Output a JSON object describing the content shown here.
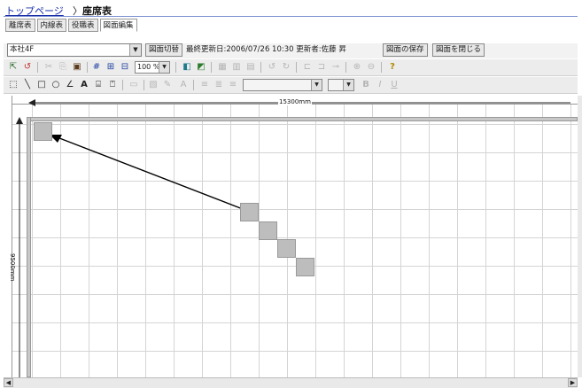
{
  "header": {
    "breadcrumb_link": "トップページ",
    "breadcrumb_sep": "〉",
    "page_title": "座席表"
  },
  "tabs": [
    {
      "label": "離席表"
    },
    {
      "label": "内線表"
    },
    {
      "label": "役職表"
    },
    {
      "label": "図面編集"
    }
  ],
  "topbar": {
    "floor_value": "本社4F",
    "switch_label": "図面切替",
    "info": "最終更新日:2006/07/26 10:30  更新者:佐藤 昇",
    "save_label": "図面の保存",
    "close_label": "図面を閉じる"
  },
  "toolbar1": {
    "zoom_value": "100 %"
  },
  "canvas": {
    "dim_top": "15300mm",
    "dim_left": "9500mm"
  },
  "colors": {
    "link": "#1a2fa8",
    "seat": "#bdbdbd",
    "grid": "#d4d4d4",
    "arrow": "#000000"
  },
  "icons": {
    "undo": "↺",
    "redo": "↻",
    "cut": "✂",
    "copy": "⎘",
    "paste": "▣",
    "grid": "#",
    "select": "⬚",
    "line": "╲",
    "rect": "□",
    "ellipse": "○",
    "polyline": "∠",
    "text": "A",
    "help": "?"
  }
}
